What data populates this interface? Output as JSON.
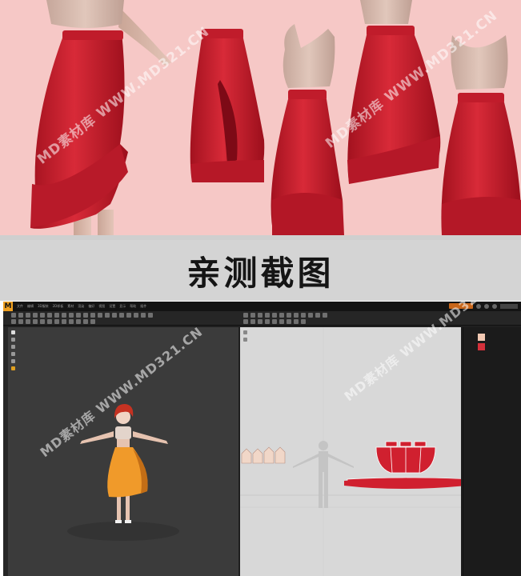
{
  "banner": {
    "background_color": "#f6c8c6",
    "skirt_color": "#cf2233",
    "top_color": "#d8b9ad",
    "watermark_text": "MD素材库 WWW.MD321.CN"
  },
  "title": {
    "text": "亲测截图"
  },
  "app": {
    "logo_letter": "M",
    "menu_items": [
      "文件",
      "编辑",
      "3D服装",
      "2D样板",
      "素材",
      "渲染",
      "偏好",
      "视图",
      "设置",
      "显示",
      "帮助",
      "插件"
    ],
    "accent_color": "#c8661a",
    "viewport_3d_color": "#3b3b3b",
    "viewport_2d_color": "#d8d8d8",
    "avatar_skirt_color": "#f09a2a",
    "pattern_color": "#d0202f",
    "swatches": [
      "#f2c9b3",
      "#d4303a"
    ]
  }
}
